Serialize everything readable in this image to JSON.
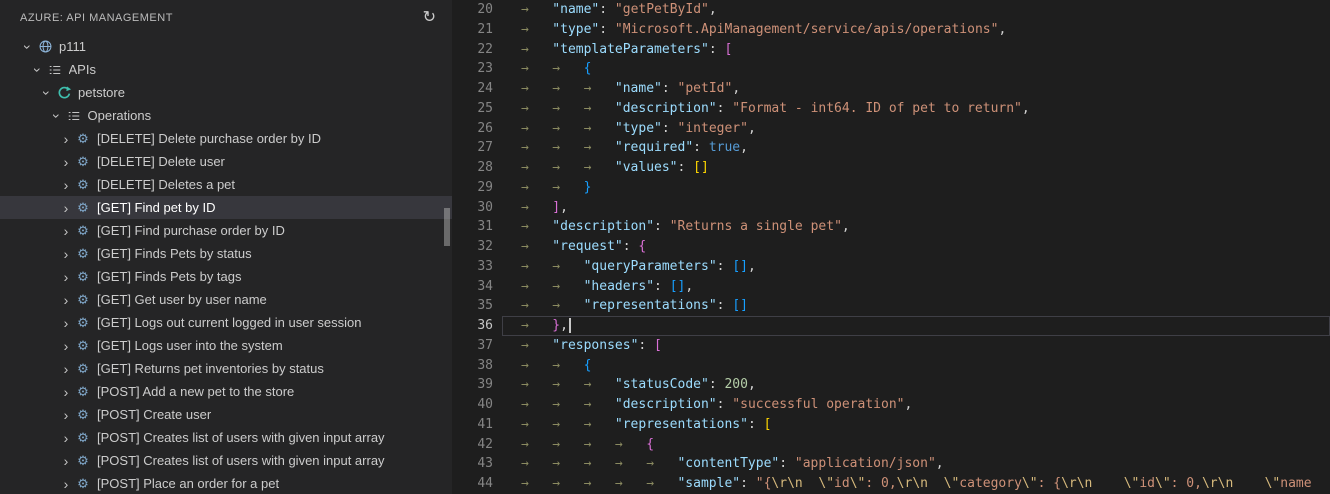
{
  "sidebar": {
    "title": "AZURE: API MANAGEMENT",
    "refresh_icon": "↻",
    "tree": [
      {
        "label": "p111",
        "level": 0,
        "expanded": true,
        "icon": "apim-service",
        "selected": false
      },
      {
        "label": "APIs",
        "level": 1,
        "expanded": true,
        "icon": "list-tree",
        "selected": false
      },
      {
        "label": "petstore",
        "level": 2,
        "expanded": true,
        "icon": "api",
        "selected": false
      },
      {
        "label": "Operations",
        "level": 3,
        "expanded": true,
        "icon": "list-tree",
        "selected": false
      },
      {
        "label": "[DELETE] Delete purchase order by ID",
        "level": 4,
        "expanded": false,
        "icon": "operation",
        "selected": false
      },
      {
        "label": "[DELETE] Delete user",
        "level": 4,
        "expanded": false,
        "icon": "operation",
        "selected": false
      },
      {
        "label": "[DELETE] Deletes a pet",
        "level": 4,
        "expanded": false,
        "icon": "operation",
        "selected": false
      },
      {
        "label": "[GET] Find pet by ID",
        "level": 4,
        "expanded": false,
        "icon": "operation",
        "selected": true
      },
      {
        "label": "[GET] Find purchase order by ID",
        "level": 4,
        "expanded": false,
        "icon": "operation",
        "selected": false
      },
      {
        "label": "[GET] Finds Pets by status",
        "level": 4,
        "expanded": false,
        "icon": "operation",
        "selected": false
      },
      {
        "label": "[GET] Finds Pets by tags",
        "level": 4,
        "expanded": false,
        "icon": "operation",
        "selected": false
      },
      {
        "label": "[GET] Get user by user name",
        "level": 4,
        "expanded": false,
        "icon": "operation",
        "selected": false
      },
      {
        "label": "[GET] Logs out current logged in user session",
        "level": 4,
        "expanded": false,
        "icon": "operation",
        "selected": false
      },
      {
        "label": "[GET] Logs user into the system",
        "level": 4,
        "expanded": false,
        "icon": "operation",
        "selected": false
      },
      {
        "label": "[GET] Returns pet inventories by status",
        "level": 4,
        "expanded": false,
        "icon": "operation",
        "selected": false
      },
      {
        "label": "[POST] Add a new pet to the store",
        "level": 4,
        "expanded": false,
        "icon": "operation",
        "selected": false
      },
      {
        "label": "[POST] Create user",
        "level": 4,
        "expanded": false,
        "icon": "operation",
        "selected": false
      },
      {
        "label": "[POST] Creates list of users with given input array",
        "level": 4,
        "expanded": false,
        "icon": "operation",
        "selected": false
      },
      {
        "label": "[POST] Creates list of users with given input array",
        "level": 4,
        "expanded": false,
        "icon": "operation",
        "selected": false
      },
      {
        "label": "[POST] Place an order for a pet",
        "level": 4,
        "expanded": false,
        "icon": "operation",
        "selected": false
      }
    ]
  },
  "editor": {
    "tab_glyph": "→",
    "cursor_line": 36,
    "lines": [
      {
        "num": 20,
        "indent": 1,
        "tokens": [
          [
            "key",
            "\"name\""
          ],
          [
            "punc",
            ": "
          ],
          [
            "str",
            "\"getPetById\""
          ],
          [
            "punc",
            ","
          ]
        ]
      },
      {
        "num": 21,
        "indent": 1,
        "tokens": [
          [
            "key",
            "\"type\""
          ],
          [
            "punc",
            ": "
          ],
          [
            "str",
            "\"Microsoft.ApiManagement/service/apis/operations\""
          ],
          [
            "punc",
            ","
          ]
        ]
      },
      {
        "num": 22,
        "indent": 1,
        "tokens": [
          [
            "key",
            "\"templateParameters\""
          ],
          [
            "punc",
            ": "
          ],
          [
            "b2",
            "["
          ]
        ]
      },
      {
        "num": 23,
        "indent": 2,
        "tokens": [
          [
            "b3",
            "{"
          ]
        ]
      },
      {
        "num": 24,
        "indent": 3,
        "tokens": [
          [
            "key",
            "\"name\""
          ],
          [
            "punc",
            ": "
          ],
          [
            "str",
            "\"petId\""
          ],
          [
            "punc",
            ","
          ]
        ]
      },
      {
        "num": 25,
        "indent": 3,
        "tokens": [
          [
            "key",
            "\"description\""
          ],
          [
            "punc",
            ": "
          ],
          [
            "str",
            "\"Format - int64. ID of pet to return\""
          ],
          [
            "punc",
            ","
          ]
        ]
      },
      {
        "num": 26,
        "indent": 3,
        "tokens": [
          [
            "key",
            "\"type\""
          ],
          [
            "punc",
            ": "
          ],
          [
            "str",
            "\"integer\""
          ],
          [
            "punc",
            ","
          ]
        ]
      },
      {
        "num": 27,
        "indent": 3,
        "tokens": [
          [
            "key",
            "\"required\""
          ],
          [
            "punc",
            ": "
          ],
          [
            "kw",
            "true"
          ],
          [
            "punc",
            ","
          ]
        ]
      },
      {
        "num": 28,
        "indent": 3,
        "tokens": [
          [
            "key",
            "\"values\""
          ],
          [
            "punc",
            ": "
          ],
          [
            "b1",
            "[]"
          ]
        ]
      },
      {
        "num": 29,
        "indent": 2,
        "tokens": [
          [
            "b3",
            "}"
          ]
        ]
      },
      {
        "num": 30,
        "indent": 1,
        "tokens": [
          [
            "b2",
            "]"
          ],
          [
            "punc",
            ","
          ]
        ]
      },
      {
        "num": 31,
        "indent": 1,
        "tokens": [
          [
            "key",
            "\"description\""
          ],
          [
            "punc",
            ": "
          ],
          [
            "str",
            "\"Returns a single pet\""
          ],
          [
            "punc",
            ","
          ]
        ]
      },
      {
        "num": 32,
        "indent": 1,
        "tokens": [
          [
            "key",
            "\"request\""
          ],
          [
            "punc",
            ": "
          ],
          [
            "b2",
            "{"
          ]
        ]
      },
      {
        "num": 33,
        "indent": 2,
        "tokens": [
          [
            "key",
            "\"queryParameters\""
          ],
          [
            "punc",
            ": "
          ],
          [
            "b3",
            "[]"
          ],
          [
            "punc",
            ","
          ]
        ]
      },
      {
        "num": 34,
        "indent": 2,
        "tokens": [
          [
            "key",
            "\"headers\""
          ],
          [
            "punc",
            ": "
          ],
          [
            "b3",
            "[]"
          ],
          [
            "punc",
            ","
          ]
        ]
      },
      {
        "num": 35,
        "indent": 2,
        "tokens": [
          [
            "key",
            "\"representations\""
          ],
          [
            "punc",
            ": "
          ],
          [
            "b3",
            "[]"
          ]
        ]
      },
      {
        "num": 36,
        "indent": 1,
        "current": true,
        "cursor": true,
        "tokens": [
          [
            "b2",
            "}"
          ],
          [
            "punc",
            ","
          ]
        ]
      },
      {
        "num": 37,
        "indent": 1,
        "tokens": [
          [
            "key",
            "\"responses\""
          ],
          [
            "punc",
            ": "
          ],
          [
            "b2",
            "["
          ]
        ]
      },
      {
        "num": 38,
        "indent": 2,
        "tokens": [
          [
            "b3",
            "{"
          ]
        ]
      },
      {
        "num": 39,
        "indent": 3,
        "tokens": [
          [
            "key",
            "\"statusCode\""
          ],
          [
            "punc",
            ": "
          ],
          [
            "num",
            "200"
          ],
          [
            "punc",
            ","
          ]
        ]
      },
      {
        "num": 40,
        "indent": 3,
        "tokens": [
          [
            "key",
            "\"description\""
          ],
          [
            "punc",
            ": "
          ],
          [
            "str",
            "\"successful operation\""
          ],
          [
            "punc",
            ","
          ]
        ]
      },
      {
        "num": 41,
        "indent": 3,
        "tokens": [
          [
            "key",
            "\"representations\""
          ],
          [
            "punc",
            ": "
          ],
          [
            "b1",
            "["
          ]
        ]
      },
      {
        "num": 42,
        "indent": 4,
        "tokens": [
          [
            "b2",
            "{"
          ]
        ]
      },
      {
        "num": 43,
        "indent": 5,
        "tokens": [
          [
            "key",
            "\"contentType\""
          ],
          [
            "punc",
            ": "
          ],
          [
            "str",
            "\"application/json\""
          ],
          [
            "punc",
            ","
          ]
        ]
      },
      {
        "num": 44,
        "indent": 5,
        "tokens": [
          [
            "key",
            "\"sample\""
          ],
          [
            "punc",
            ": "
          ],
          [
            "str",
            "\"{"
          ],
          [
            "esc",
            "\\r\\n"
          ],
          [
            "str",
            "  "
          ],
          [
            "esc",
            "\\\""
          ],
          [
            "str",
            "id"
          ],
          [
            "esc",
            "\\\""
          ],
          [
            "str",
            ": 0,"
          ],
          [
            "esc",
            "\\r\\n"
          ],
          [
            "str",
            "  "
          ],
          [
            "esc",
            "\\\""
          ],
          [
            "str",
            "category"
          ],
          [
            "esc",
            "\\\""
          ],
          [
            "str",
            ": {"
          ],
          [
            "esc",
            "\\r\\n"
          ],
          [
            "str",
            "    "
          ],
          [
            "esc",
            "\\\""
          ],
          [
            "str",
            "id"
          ],
          [
            "esc",
            "\\\""
          ],
          [
            "str",
            ": 0,"
          ],
          [
            "esc",
            "\\r\\n"
          ],
          [
            "str",
            "    "
          ],
          [
            "esc",
            "\\\""
          ],
          [
            "str",
            "name"
          ]
        ]
      }
    ]
  },
  "colors": {
    "sidebar_bg": "#252526",
    "editor_bg": "#1e1e1e",
    "selected_row_bg": "#37373d",
    "json_key": "#9cdcfe",
    "json_string": "#ce9178",
    "json_escape": "#d7ba7d",
    "json_number": "#b5cea8",
    "json_keyword": "#569cd6",
    "bracket_gold": "#ffd700",
    "bracket_orchid": "#da70d6",
    "bracket_blue": "#179fff",
    "line_number": "#858585",
    "active_line_number": "#c6c6c6",
    "whitespace_tab": "#8a8a60"
  }
}
